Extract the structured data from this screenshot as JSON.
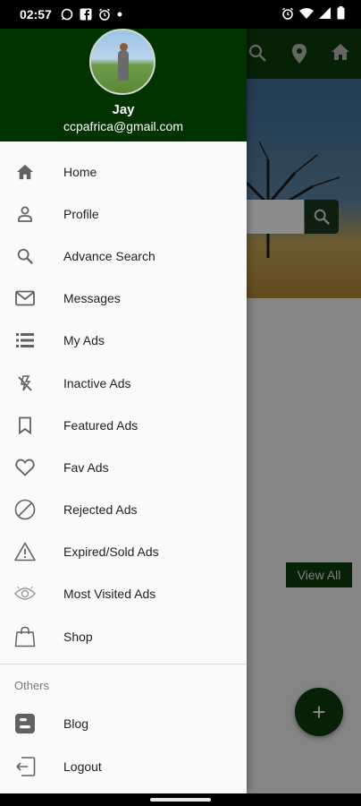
{
  "status_bar": {
    "time": "02:57",
    "left_icons": [
      "whatsapp-icon",
      "facebook-icon",
      "alarm-icon",
      "dot-icon"
    ],
    "right_icons": [
      "alarm-icon",
      "wifi-icon",
      "signal-icon",
      "battery-icon"
    ]
  },
  "background_app": {
    "toolbar_icons": [
      "search-icon",
      "location-icon",
      "home-icon"
    ],
    "view_all_label": "View All",
    "fab_label": "+"
  },
  "drawer": {
    "user": {
      "name": "Jay",
      "email": "ccpafrica@gmail.com"
    },
    "items": [
      {
        "label": "Home",
        "icon": "home-icon"
      },
      {
        "label": "Profile",
        "icon": "person-icon"
      },
      {
        "label": "Advance Search",
        "icon": "search-icon"
      },
      {
        "label": "Messages",
        "icon": "mail-icon"
      },
      {
        "label": "My Ads",
        "icon": "list-icon"
      },
      {
        "label": "Inactive Ads",
        "icon": "flash-off-icon"
      },
      {
        "label": "Featured Ads",
        "icon": "bookmark-icon"
      },
      {
        "label": "Fav Ads",
        "icon": "heart-icon"
      },
      {
        "label": "Rejected Ads",
        "icon": "block-icon"
      },
      {
        "label": "Expired/Sold  Ads",
        "icon": "warning-icon"
      },
      {
        "label": "Most Visited Ads",
        "icon": "eye-icon"
      },
      {
        "label": "Shop",
        "icon": "shopping-bag-icon"
      }
    ],
    "section_title": "Others",
    "others": [
      {
        "label": "Blog",
        "icon": "blogger-icon"
      },
      {
        "label": "Logout",
        "icon": "logout-icon"
      }
    ]
  },
  "colors": {
    "header_green": "#003300",
    "toolbar_green": "#0b3d0b",
    "drawer_bg": "#fafafa",
    "icon_gray": "#616161"
  }
}
